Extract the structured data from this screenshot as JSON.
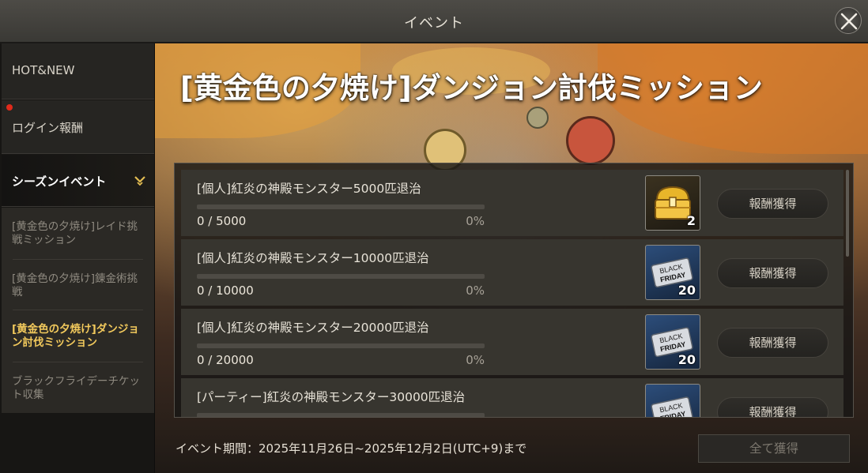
{
  "window": {
    "title": "イベント"
  },
  "sidebar": {
    "tabs": [
      {
        "label": "HOT&NEW"
      },
      {
        "label": "ログイン報酬",
        "notification": true
      },
      {
        "label": "シーズンイベント"
      }
    ],
    "sub_items": [
      {
        "label": "[黄金色の夕焼け]レイド挑戦ミッション"
      },
      {
        "label": "[黄金色の夕焼け]錬金術挑戦"
      },
      {
        "label": "[黄金色の夕焼け]ダンジョン討伐ミッション"
      },
      {
        "label": "ブラックフライデーチケット収集"
      }
    ]
  },
  "main": {
    "title": "[黄金色の夕焼け]ダンジョン討伐ミッション",
    "missions": [
      {
        "name": "[個人]紅炎の神殿モンスター5000匹退治",
        "progress": "0 / 5000",
        "percent": "0%",
        "reward_icon": "gold-chest-icon",
        "reward_qty": "2",
        "button": "報酬獲得"
      },
      {
        "name": "[個人]紅炎の神殿モンスター10000匹退治",
        "progress": "0 / 10000",
        "percent": "0%",
        "reward_icon": "black-friday-ticket-icon",
        "reward_qty": "20",
        "button": "報酬獲得"
      },
      {
        "name": "[個人]紅炎の神殿モンスター20000匹退治",
        "progress": "0 / 20000",
        "percent": "0%",
        "reward_icon": "black-friday-ticket-icon",
        "reward_qty": "20",
        "button": "報酬獲得"
      },
      {
        "name": "[パーティー]紅炎の神殿モンスター30000匹退治",
        "progress": "",
        "percent": "",
        "reward_icon": "black-friday-ticket-icon",
        "reward_qty": "",
        "button": "報酬獲得"
      }
    ],
    "ticket_text": {
      "line1": "BLACK",
      "line2": "FRIDAY"
    },
    "period": "イベント期間：2025年11月26日~2025年12月2日(UTC+9)まで",
    "claim_all": "全て獲得"
  },
  "colors": {
    "accent": "#f2c95c",
    "notification": "#e02a1b",
    "progress": "#d9b24a"
  }
}
